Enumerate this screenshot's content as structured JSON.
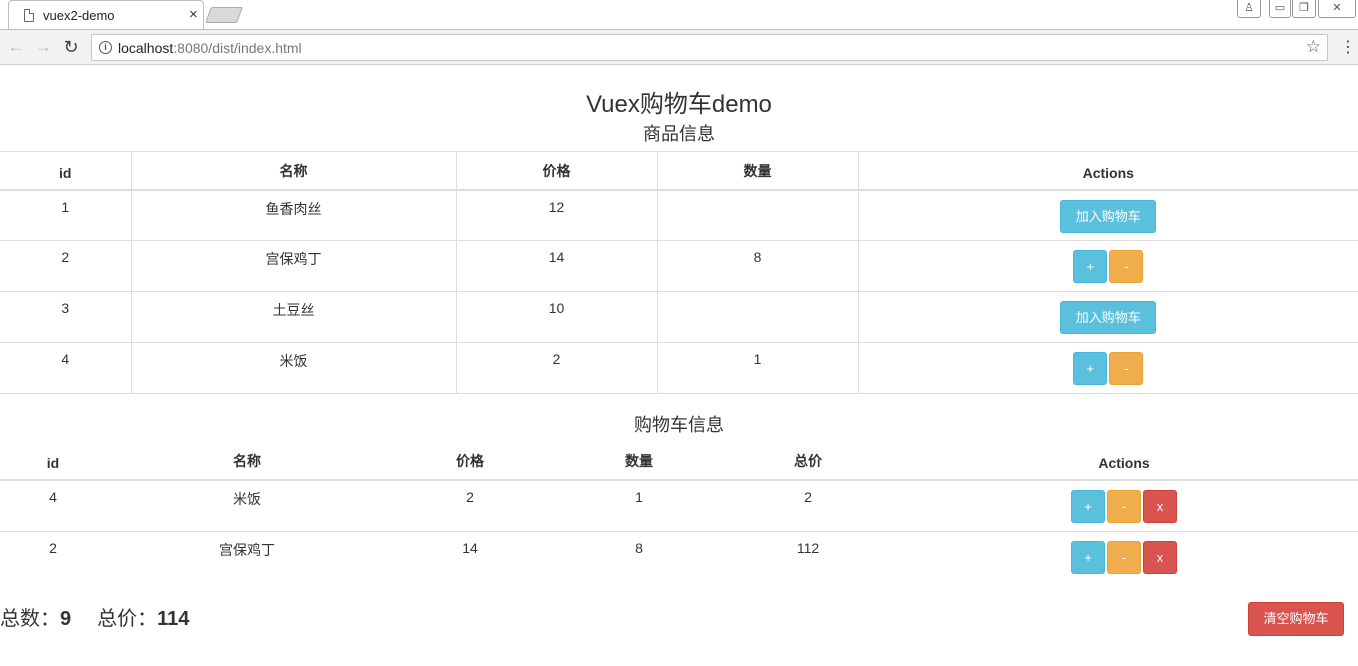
{
  "browser": {
    "tab_title": "vuex2-demo",
    "tab_close": "×",
    "url_host": "localhost",
    "url_rest": ":8080/dist/index.html",
    "nav": {
      "back": "←",
      "forward": "→",
      "reload": "↻"
    },
    "icons": {
      "info": "i",
      "star": "☆",
      "menu": "⋮",
      "user": "♙",
      "minimize": "▭",
      "maximize": "❐",
      "close": "✕"
    }
  },
  "page": {
    "title": "Vuex购物车demo",
    "products_title": "商品信息",
    "cart_title": "购物车信息"
  },
  "products": {
    "columns": [
      "id",
      "名称",
      "价格",
      "数量",
      "Actions"
    ],
    "add_label": "加入购物车",
    "plus_label": "+",
    "minus_label": "-",
    "rows": [
      {
        "id": "1",
        "name": "鱼香肉丝",
        "price": "12",
        "qty": "",
        "in_cart": false
      },
      {
        "id": "2",
        "name": "宫保鸡丁",
        "price": "14",
        "qty": "8",
        "in_cart": true
      },
      {
        "id": "3",
        "name": "土豆丝",
        "price": "10",
        "qty": "",
        "in_cart": false
      },
      {
        "id": "4",
        "name": "米饭",
        "price": "2",
        "qty": "1",
        "in_cart": true
      }
    ]
  },
  "cart": {
    "columns": [
      "id",
      "名称",
      "价格",
      "数量",
      "总价",
      "Actions"
    ],
    "plus_label": "+",
    "minus_label": "-",
    "remove_label": "x",
    "rows": [
      {
        "id": "4",
        "name": "米饭",
        "price": "2",
        "qty": "1",
        "total": "2"
      },
      {
        "id": "2",
        "name": "宫保鸡丁",
        "price": "14",
        "qty": "8",
        "total": "112"
      }
    ]
  },
  "summary": {
    "count_label": "总数：",
    "count_value": "9",
    "price_label": "总价：",
    "price_value": "114",
    "clear_label": "清空购物车"
  },
  "colors": {
    "info": "#5bc0de",
    "warning": "#f0ad4e",
    "danger": "#d9534f"
  }
}
